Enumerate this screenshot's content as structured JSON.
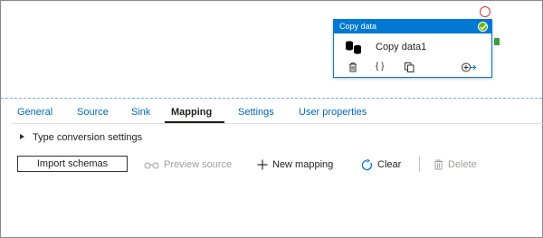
{
  "activity": {
    "header_title": "Copy data",
    "name": "Copy data1",
    "toolbar_icons": [
      "delete-icon",
      "code-braces-icon",
      "copy-icon",
      "add-output-icon"
    ],
    "header_color": "#0078d4",
    "status": "success"
  },
  "tabs": [
    {
      "label": "General",
      "active": false
    },
    {
      "label": "Source",
      "active": false
    },
    {
      "label": "Sink",
      "active": false
    },
    {
      "label": "Mapping",
      "active": true
    },
    {
      "label": "Settings",
      "active": false
    },
    {
      "label": "User properties",
      "active": false
    }
  ],
  "mapping": {
    "type_conversion_label": "Type conversion settings",
    "import_schemas_label": "Import schemas",
    "preview_source_label": "Preview source",
    "new_mapping_label": "New mapping",
    "clear_label": "Clear",
    "delete_label": "Delete"
  },
  "colors": {
    "accent": "#0078d4",
    "link": "#0067b8",
    "success": "#6bb700",
    "disabled": "#a19f9d"
  }
}
